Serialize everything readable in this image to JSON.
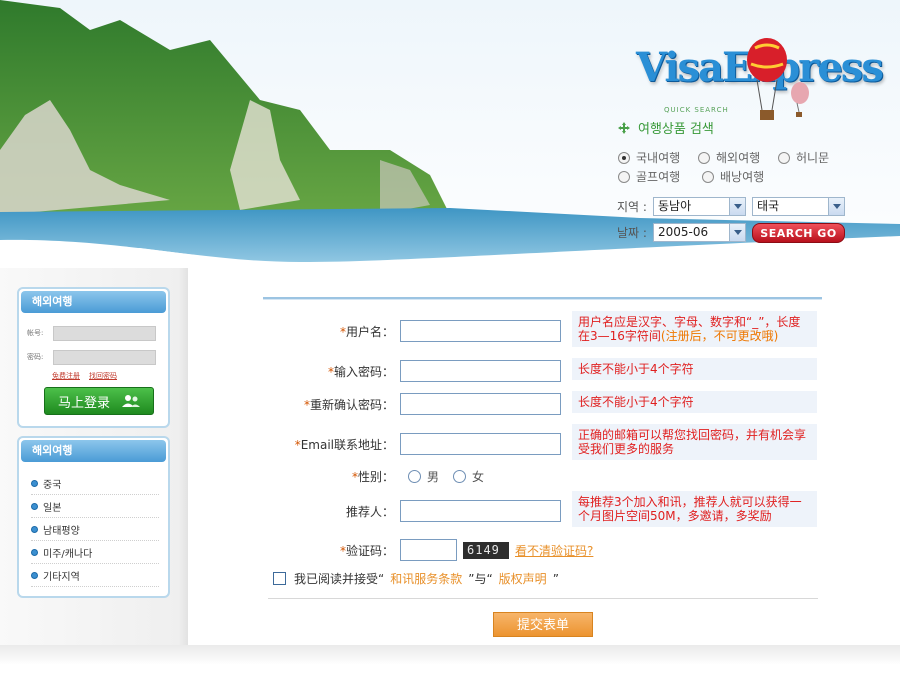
{
  "brand": {
    "logo_text": "VisaExpress"
  },
  "quick_search": {
    "subtitle": "QUICK SEARCH",
    "title": "여행상품 검색",
    "trip_types": [
      {
        "label": "국내여행",
        "selected": true
      },
      {
        "label": "해외여행",
        "selected": false
      },
      {
        "label": "허니문",
        "selected": false
      },
      {
        "label": "골프여행",
        "selected": false
      },
      {
        "label": "배낭여행",
        "selected": false
      }
    ],
    "region_label": "지역 :",
    "region_value": "동남아",
    "country_value": "태국",
    "date_label": "날짜 :",
    "date_value": "2005-06",
    "search_button": "SEARCH GO"
  },
  "login_panel": {
    "title": "해외여행",
    "id_label": "帐号:",
    "pw_label": "密码:",
    "links": [
      "免费注册",
      "找回密码"
    ],
    "login_button": "马上登录"
  },
  "nav_panel": {
    "title": "해외여행",
    "items": [
      "중국",
      "일본",
      "남태평양",
      "미주/캐나다",
      "기타지역"
    ]
  },
  "form": {
    "username": {
      "label": "用户名：",
      "tip": "用户名应是汉字、字母、数字和“_”，长度在3—16字符间",
      "tip_note": "(注册后，不可更改哦)"
    },
    "password": {
      "label": "输入密码：",
      "tip": "长度不能小于4个字符"
    },
    "confirm": {
      "label": "重新确认密码：",
      "tip": "长度不能小于4个字符"
    },
    "email": {
      "label": "Email联系地址：",
      "tip": "正确的邮箱可以帮您找回密码，并有机会享受我们更多的服务"
    },
    "gender": {
      "label": "性别：",
      "male": "男",
      "female": "女"
    },
    "referrer": {
      "label": "推荐人：",
      "tip": "每推荐3个加入和讯，推荐人就可以获得一个月图片空间50M，多邀请，多奖励"
    },
    "captcha": {
      "label": "验证码：",
      "code": "6149",
      "refresh_link": "看不清验证码?"
    },
    "agree": {
      "prefix": "我已阅读并接受“",
      "terms": "和讯服务条款",
      "middle": "”与“",
      "copyright": "版权声明",
      "suffix": "”"
    },
    "submit": "提交表单"
  }
}
